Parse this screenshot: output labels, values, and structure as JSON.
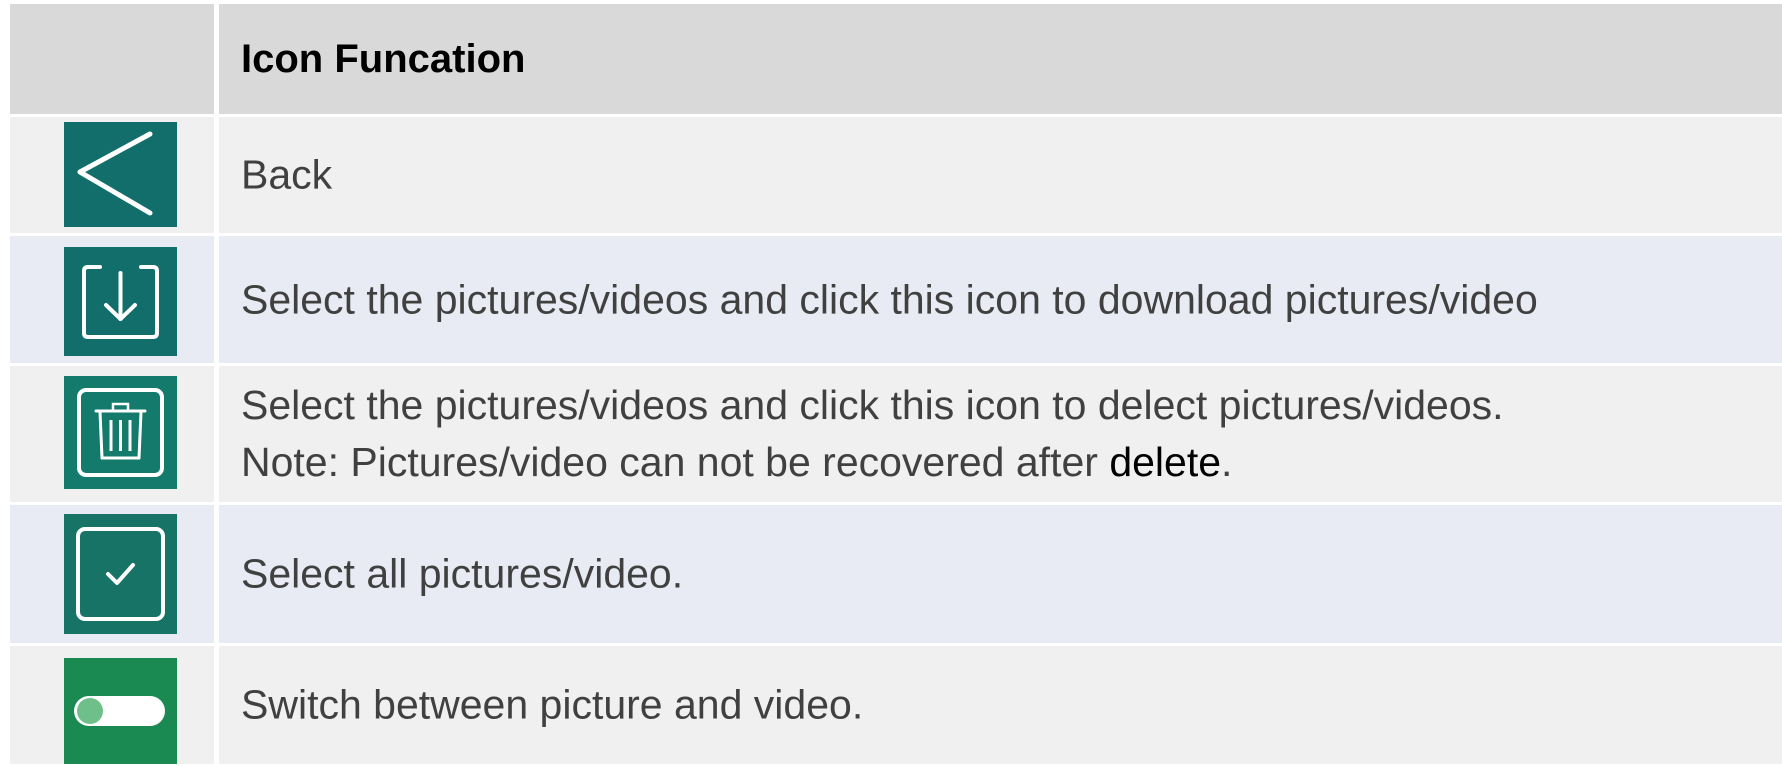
{
  "table": {
    "header": {
      "function_label": "Icon Funcation"
    },
    "rows": [
      {
        "icon": "back-chevron-icon",
        "icon_color": "#116e6a",
        "text": "Back"
      },
      {
        "icon": "download-icon",
        "icon_color": "#116e6a",
        "text": "Select the pictures/videos and click this icon to download pictures/video"
      },
      {
        "icon": "trash-icon",
        "icon_color": "#137a6c",
        "line1": "Select the pictures/videos and click this icon to delect pictures/videos.",
        "line2_prefix": "Note: Pictures/video can not be recovered after ",
        "line2_keyword": "delete",
        "line2_suffix": "."
      },
      {
        "icon": "select-all-checkbox-icon",
        "icon_color": "#177366",
        "text": "Select all pictures/video."
      },
      {
        "icon": "toggle-switch-icon",
        "icon_color": "#1a8a52",
        "text": "Switch between picture and video."
      }
    ]
  }
}
